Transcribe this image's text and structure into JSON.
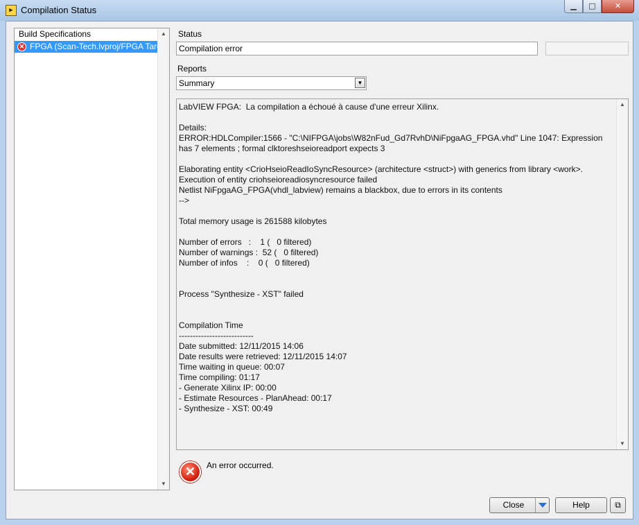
{
  "window": {
    "title": "Compilation Status",
    "app_icon": "labview-icon",
    "controls": {
      "minimize": "▁",
      "maximize": "□",
      "close": "✕"
    }
  },
  "tree": {
    "header": "Build Specifications",
    "items": [
      {
        "label": "FPGA (Scan-Tech.lvproj/FPGA Targ",
        "status_icon": "error-icon",
        "selected": true
      }
    ]
  },
  "status": {
    "label": "Status",
    "value": "Compilation error"
  },
  "reports": {
    "label": "Reports",
    "selected": "Summary"
  },
  "report_text": "LabVIEW FPGA:  La compilation a échoué à cause d'une erreur Xilinx.\n\nDetails:\nERROR:HDLCompiler:1566 - \"C:\\NIFPGA\\jobs\\W82nFud_Gd7RvhD\\NiFpgaAG_FPGA.vhd\" Line 1047: Expression has 7 elements ; formal clktoreshseioreadport expects 3\n\nElaborating entity <CrioHseioReadIoSyncResource> (architecture <struct>) with generics from library <work>.\nExecution of entity criohseioreadiosyncresource failed\nNetlist NiFpgaAG_FPGA(vhdl_labview) remains a blackbox, due to errors in its contents\n-->\n\nTotal memory usage is 261588 kilobytes\n\nNumber of errors   :    1 (   0 filtered)\nNumber of warnings :  52 (   0 filtered)\nNumber of infos    :    0 (   0 filtered)\n\n\nProcess \"Synthesize - XST\" failed\n\n\nCompilation Time\n---------------------------\nDate submitted: 12/11/2015 14:06\nDate results were retrieved: 12/11/2015 14:07\nTime waiting in queue: 00:07\nTime compiling: 01:17\n- Generate Xilinx IP: 00:00\n- Estimate Resources - PlanAhead: 00:17\n- Synthesize - XST: 00:49",
  "message": {
    "text": "An error occurred.",
    "icon": "error-icon"
  },
  "buttons": {
    "close": "Close",
    "help": "Help",
    "icon_button": "⧉"
  },
  "colors": {
    "selection": "#3399ff",
    "error": "#d0200e",
    "accent": "#2b6fd6"
  }
}
